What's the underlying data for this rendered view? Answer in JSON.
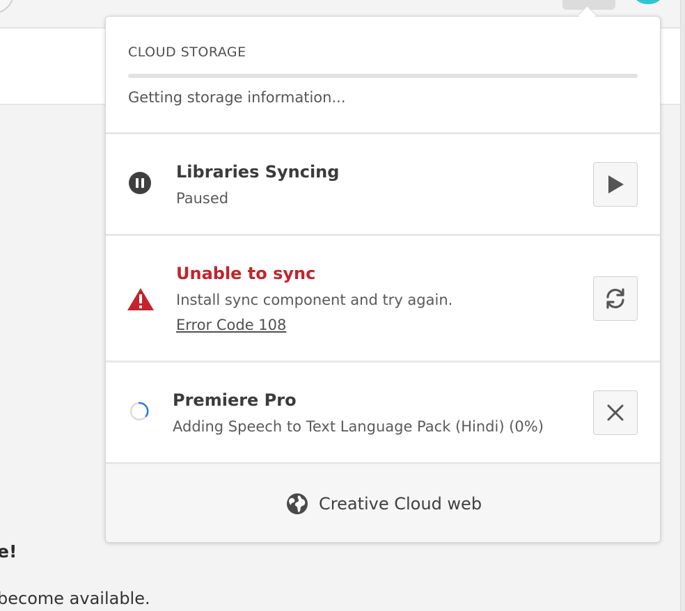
{
  "background": {
    "heading_fragment": "e!",
    "body_fragment": "become available."
  },
  "storage": {
    "title": "CLOUD STORAGE",
    "status": "Getting storage information...",
    "progress_fraction": 0
  },
  "libraries": {
    "title": "Libraries Syncing",
    "status": "Paused",
    "status_icon": "pause-icon",
    "action_icon": "play-icon"
  },
  "sync_error": {
    "title": "Unable to sync",
    "message": "Install sync component and try again.",
    "error_link": "Error Code 108",
    "status_icon": "warning-icon",
    "action_icon": "refresh-icon",
    "color": "#c3242c"
  },
  "premiere": {
    "title": "Premiere Pro",
    "status": "Adding Speech to Text Language Pack (Hindi) (0%)",
    "status_icon": "spinner-icon",
    "action_icon": "close-icon",
    "spinner_color": "#2d7be5"
  },
  "footer": {
    "link_label": "Creative Cloud web",
    "icon": "globe-icon"
  }
}
